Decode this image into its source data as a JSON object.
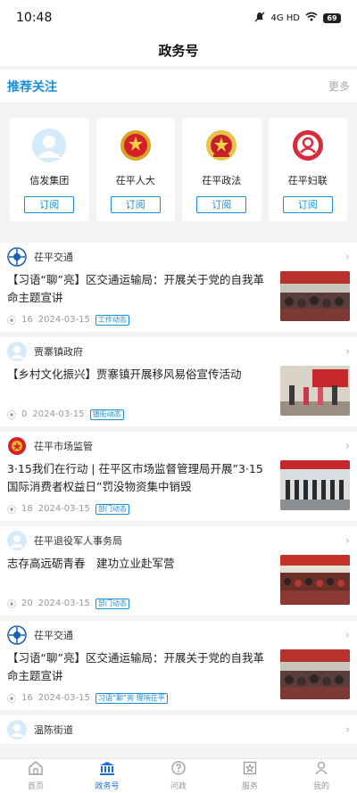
{
  "status": {
    "time": "10:48",
    "network": "4G HD",
    "battery": "69"
  },
  "header": {
    "title": "政务号"
  },
  "recommend": {
    "title": "推荐关注",
    "more": "更多",
    "cards": [
      {
        "name": "信发集团",
        "subscribe": "订阅",
        "icon": "user-avatar-icon"
      },
      {
        "name": "茌平人大",
        "subscribe": "订阅",
        "icon": "national-emblem-icon"
      },
      {
        "name": "茌平政法",
        "subscribe": "订阅",
        "icon": "politics-law-emblem-icon"
      },
      {
        "name": "茌平妇联",
        "subscribe": "订阅",
        "icon": "womens-federation-logo-icon"
      }
    ]
  },
  "feed": [
    {
      "source": "茌平交通",
      "title": "【习语“聊”亮】区交通运输局：开展关于党的自我革命主题宣讲",
      "views": "16",
      "date": "2024-03-15",
      "tag": "工作动态"
    },
    {
      "source": "贾寨镇政府",
      "title": "【乡村文化振兴】贾寨镇开展移风易俗宣传活动",
      "views": "0",
      "date": "2024-03-15",
      "tag": "镇街动态"
    },
    {
      "source": "茌平市场监管",
      "title": "3·15我们在行动 | 茌平区市场监督管理局开展”3·15国际消费者权益日”罚没物资集中销毁",
      "views": "18",
      "date": "2024-03-15",
      "tag": "部门动态"
    },
    {
      "source": "茌平退役军人事务局",
      "title": "志存高远砺青春　建功立业赴军营",
      "views": "20",
      "date": "2024-03-15",
      "tag": "部门动态"
    },
    {
      "source": "茌平交通",
      "title": "【习语“聊”亮】区交通运输局：开展关于党的自我革命主题宣讲",
      "views": "16",
      "date": "2024-03-15",
      "tag": "习语“聊”亮 理响茌平"
    },
    {
      "source": "温陈街道",
      "title": "",
      "views": "",
      "date": "",
      "tag": ""
    }
  ],
  "tabs": [
    {
      "label": "首页",
      "icon": "home-icon"
    },
    {
      "label": "政务号",
      "icon": "government-building-icon"
    },
    {
      "label": "问政",
      "icon": "question-icon"
    },
    {
      "label": "服务",
      "icon": "service-star-icon"
    },
    {
      "label": "我的",
      "icon": "profile-icon"
    }
  ],
  "colors": {
    "accent": "#1b8ed8",
    "active_tab": "#1b6fd8"
  }
}
